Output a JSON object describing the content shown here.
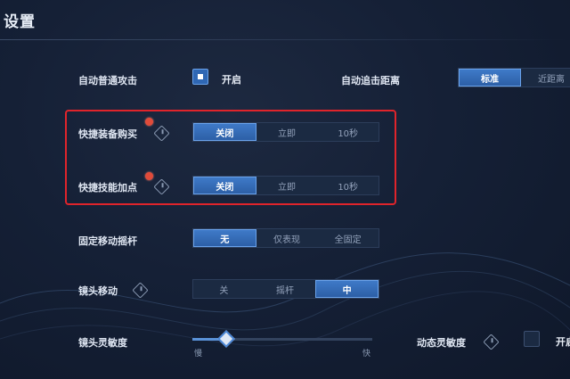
{
  "header": {
    "title": "设置"
  },
  "settings": {
    "auto_attack": {
      "label": "自动普通攻击",
      "checked": true,
      "checkbox_text": "开启"
    },
    "auto_chase": {
      "label": "自动追击距离",
      "options": [
        "标准",
        "近距离"
      ],
      "selected": 0
    },
    "quick_buy": {
      "label": "快捷装备购买",
      "options": [
        "关闭",
        "立即",
        "10秒"
      ],
      "selected": 0
    },
    "quick_skill": {
      "label": "快捷技能加点",
      "options": [
        "关闭",
        "立即",
        "10秒"
      ],
      "selected": 0
    },
    "joystick": {
      "label": "固定移动摇杆",
      "options": [
        "无",
        "仅表现",
        "全固定"
      ],
      "selected": 0
    },
    "camera_move": {
      "label": "镜头移动",
      "options": [
        "关",
        "摇杆",
        "中"
      ],
      "selected": 2
    },
    "camera_sensitivity": {
      "label": "镜头灵敏度",
      "min_label": "慢",
      "max_label": "快",
      "level_fraction": 0.19
    },
    "dynamic_sensitivity": {
      "label": "动态灵敏度",
      "checked": false,
      "checkbox_text": "开启"
    }
  },
  "colors": {
    "accent": "#2f67b4",
    "highlight_border": "#e0242b",
    "badge": "#e04b3a"
  }
}
